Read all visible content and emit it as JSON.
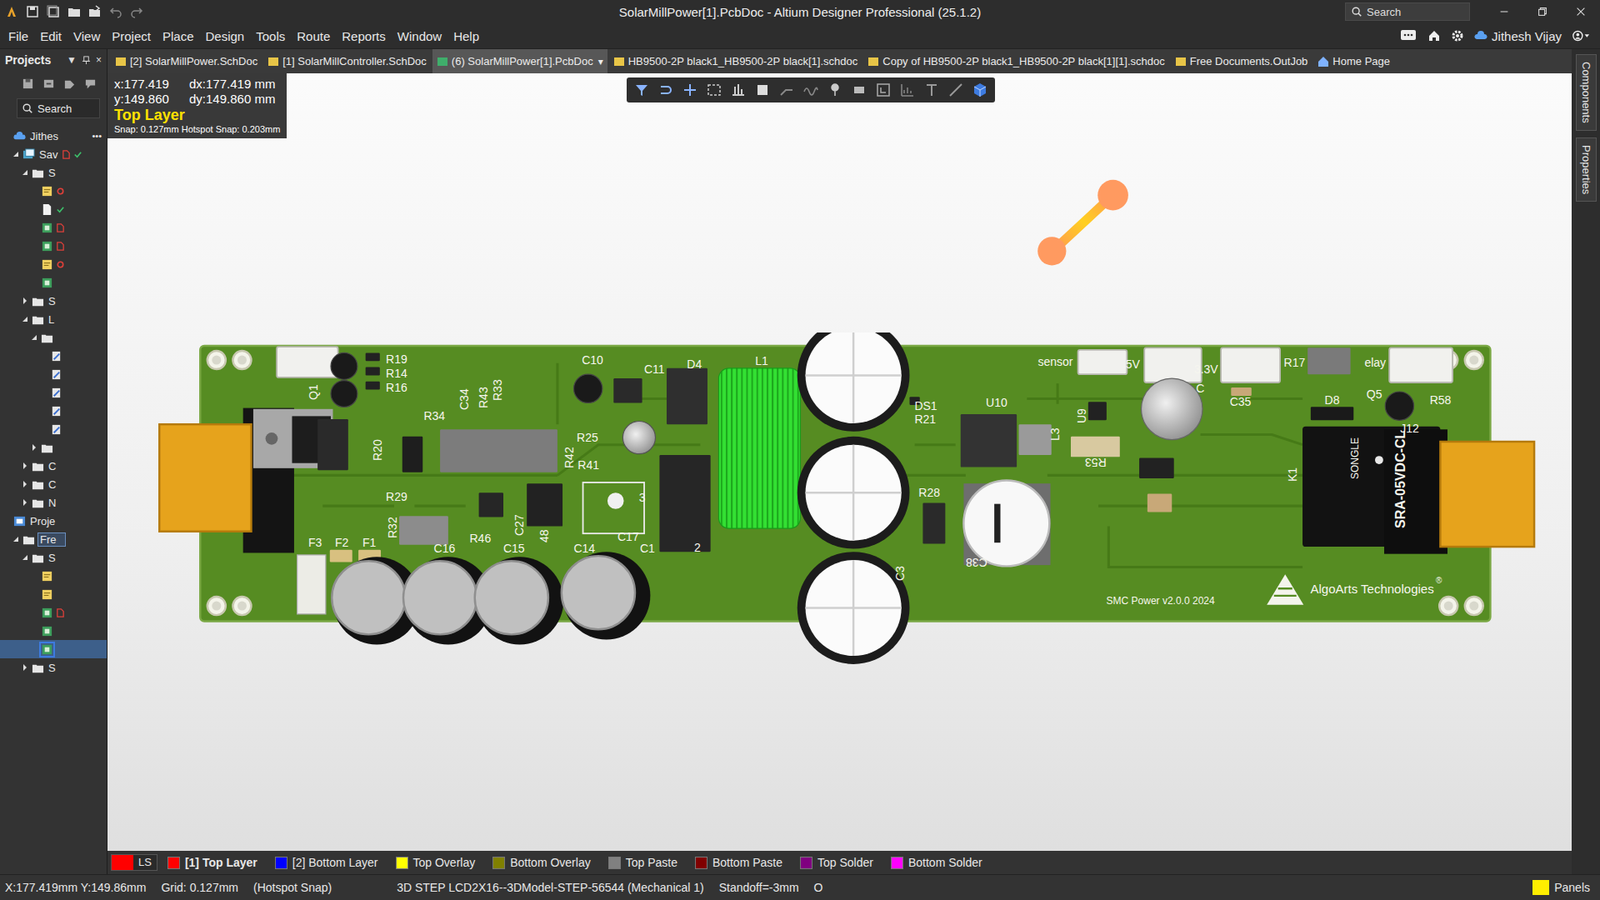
{
  "window": {
    "title": "SolarMillPower[1].PcbDoc - Altium Designer Professional (25.1.2)"
  },
  "title_bar": {
    "search": {
      "placeholder": "Search"
    }
  },
  "menu": [
    "File",
    "Edit",
    "View",
    "Project",
    "Place",
    "Design",
    "Tools",
    "Route",
    "Reports",
    "Window",
    "Help"
  ],
  "account": {
    "name": "Jithesh Vijay"
  },
  "doc_tabs": {
    "dropdown_glyph": "▾",
    "items": [
      {
        "label": "[2] SolarMillPower.SchDoc",
        "kind": "sch",
        "selected": false,
        "dropdown": false
      },
      {
        "label": "[1] SolarMillController.SchDoc",
        "kind": "sch",
        "selected": false,
        "dropdown": false
      },
      {
        "label": "(6) SolarMillPower[1].PcbDoc",
        "kind": "pcb",
        "selected": true,
        "dropdown": true
      },
      {
        "label": "HB9500-2P black1_HB9500-2P black[1].schdoc",
        "kind": "sch",
        "selected": false,
        "dropdown": false
      },
      {
        "label": "Copy of HB9500-2P black1_HB9500-2P black[1][1].schdoc",
        "kind": "sch",
        "selected": false,
        "dropdown": false
      },
      {
        "label": "Free Documents.OutJob",
        "kind": "outjob",
        "selected": false,
        "dropdown": false
      },
      {
        "label": "Home Page",
        "kind": "home",
        "selected": false,
        "dropdown": false
      }
    ]
  },
  "projects_panel": {
    "title": "Projects",
    "menu_glyph": "▼",
    "close_glyph": "×",
    "search": {
      "placeholder": "Search"
    },
    "more": "•••",
    "tree": [
      {
        "label": "Jithes",
        "depth": 0,
        "kind": "cloud",
        "expandable": false,
        "expanded": false,
        "marks": [],
        "outlined": false,
        "selected": false
      },
      {
        "label": "Sav",
        "depth": 1,
        "kind": "workspace",
        "expandable": true,
        "expanded": true,
        "marks": [
          "modified",
          "saved"
        ],
        "outlined": false,
        "selected": false
      },
      {
        "label": "S",
        "depth": 2,
        "kind": "folder",
        "expandable": true,
        "expanded": true,
        "marks": [],
        "outlined": false,
        "selected": false
      },
      {
        "label": "",
        "depth": 3,
        "kind": "sch",
        "expandable": false,
        "expanded": false,
        "marks": [
          "unsaved"
        ],
        "outlined": false,
        "selected": false
      },
      {
        "label": "",
        "depth": 3,
        "kind": "doc",
        "expandable": false,
        "expanded": false,
        "marks": [
          "saved"
        ],
        "outlined": false,
        "selected": false
      },
      {
        "label": "",
        "depth": 3,
        "kind": "pcb",
        "expandable": false,
        "expanded": false,
        "marks": [
          "modified"
        ],
        "outlined": false,
        "selected": false
      },
      {
        "label": "",
        "depth": 3,
        "kind": "pcb",
        "expandable": false,
        "expanded": false,
        "marks": [
          "modified"
        ],
        "outlined": false,
        "selected": false
      },
      {
        "label": "",
        "depth": 3,
        "kind": "sch",
        "expandable": false,
        "expanded": false,
        "marks": [
          "unsaved"
        ],
        "outlined": false,
        "selected": false
      },
      {
        "label": "",
        "depth": 3,
        "kind": "pcb",
        "expandable": false,
        "expanded": false,
        "marks": [],
        "outlined": false,
        "selected": false
      },
      {
        "label": "S",
        "depth": 2,
        "kind": "folder",
        "expandable": true,
        "expanded": false,
        "marks": [],
        "outlined": false,
        "selected": false
      },
      {
        "label": "L",
        "depth": 2,
        "kind": "folder",
        "expandable": true,
        "expanded": true,
        "marks": [],
        "outlined": false,
        "selected": false
      },
      {
        "label": "",
        "depth": 3,
        "kind": "folder",
        "expandable": true,
        "expanded": true,
        "marks": [],
        "outlined": false,
        "selected": false
      },
      {
        "label": "",
        "depth": 4,
        "kind": "lib",
        "expandable": false,
        "expanded": false,
        "marks": [],
        "outlined": false,
        "selected": false
      },
      {
        "label": "",
        "depth": 4,
        "kind": "lib",
        "expandable": false,
        "expanded": false,
        "marks": [],
        "outlined": false,
        "selected": false
      },
      {
        "label": "",
        "depth": 4,
        "kind": "lib",
        "expandable": false,
        "expanded": false,
        "marks": [],
        "outlined": false,
        "selected": false
      },
      {
        "label": "",
        "depth": 4,
        "kind": "lib",
        "expandable": false,
        "expanded": false,
        "marks": [],
        "outlined": false,
        "selected": false
      },
      {
        "label": "",
        "depth": 4,
        "kind": "lib",
        "expandable": false,
        "expanded": false,
        "marks": [],
        "outlined": false,
        "selected": false
      },
      {
        "label": "",
        "depth": 3,
        "kind": "folder",
        "expandable": true,
        "expanded": false,
        "marks": [],
        "outlined": false,
        "selected": false
      },
      {
        "label": "C",
        "depth": 2,
        "kind": "folder",
        "expandable": true,
        "expanded": false,
        "marks": [],
        "outlined": false,
        "selected": false
      },
      {
        "label": "C",
        "depth": 2,
        "kind": "folder",
        "expandable": true,
        "expanded": false,
        "marks": [],
        "outlined": false,
        "selected": false
      },
      {
        "label": "N",
        "depth": 2,
        "kind": "folder",
        "expandable": true,
        "expanded": false,
        "marks": [],
        "outlined": false,
        "selected": false
      },
      {
        "label": "Proje",
        "depth": 0,
        "kind": "project",
        "expandable": false,
        "expanded": false,
        "marks": [],
        "outlined": false,
        "selected": false
      },
      {
        "label": "Fre",
        "depth": 1,
        "kind": "folder",
        "expandable": true,
        "expanded": true,
        "marks": [],
        "outlined": true,
        "selected": false
      },
      {
        "label": "S",
        "depth": 2,
        "kind": "folder",
        "expandable": true,
        "expanded": true,
        "marks": [],
        "outlined": false,
        "selected": false
      },
      {
        "label": "",
        "depth": 3,
        "kind": "sch",
        "expandable": false,
        "expanded": false,
        "marks": [],
        "outlined": false,
        "selected": false
      },
      {
        "label": "",
        "depth": 3,
        "kind": "sch",
        "expandable": false,
        "expanded": false,
        "marks": [],
        "outlined": false,
        "selected": false
      },
      {
        "label": "",
        "depth": 3,
        "kind": "pcb",
        "expandable": false,
        "expanded": false,
        "marks": [
          "modified"
        ],
        "outlined": false,
        "selected": false
      },
      {
        "label": "",
        "depth": 3,
        "kind": "pcb",
        "expandable": false,
        "expanded": false,
        "marks": [],
        "outlined": false,
        "selected": false
      },
      {
        "label": "",
        "depth": 3,
        "kind": "pcb",
        "expandable": false,
        "expanded": false,
        "marks": [],
        "outlined": false,
        "selected": true
      },
      {
        "label": "S",
        "depth": 2,
        "kind": "folder",
        "expandable": true,
        "expanded": false,
        "marks": [],
        "outlined": false,
        "selected": false
      }
    ]
  },
  "right_panels": [
    {
      "label": "Components"
    },
    {
      "label": "Properties"
    }
  ],
  "hud": {
    "rows": [
      {
        "abs": "x:177.419",
        "delta": "dx:177.419 mm"
      },
      {
        "abs": "y:149.860",
        "delta": "dy:149.860 mm"
      }
    ],
    "layer": "Top Layer",
    "snap": "Snap: 0.127mm Hotspot Snap: 0.203mm"
  },
  "board": {
    "labels": [
      "R19",
      "R14",
      "R16",
      "Q1",
      "R20",
      "C10",
      "C11",
      "D4",
      "L1",
      "C34",
      "R43",
      "R33",
      "R34",
      "R25",
      "R42",
      "R41",
      "R29",
      "R32",
      "C16",
      "R46",
      "C15",
      "C27",
      "48",
      "C14",
      "C1",
      "C17",
      "3",
      "2",
      "DS1",
      "R21",
      "U10",
      "L3",
      "U9",
      "R53",
      "R28",
      "C38",
      "C3",
      "sensor",
      "5V",
      "3.3V",
      "R17",
      "elay",
      "C35",
      "D8",
      "Q5",
      "R58",
      "J12",
      "K1",
      "F3",
      "F2",
      "F1",
      "C"
    ],
    "version": "SMC Power v2.0.0 2024",
    "company": "AlgoArts Technologies",
    "trademark": "®",
    "relay_brand": "SONGLE",
    "relay_part": "SRA-05VDC-CL"
  },
  "layer_bar": {
    "ls": {
      "label": "LS",
      "color": "#ff0000"
    },
    "layers": [
      {
        "label": "[1] Top Layer",
        "color": "#ff0000",
        "selected": true
      },
      {
        "label": "[2] Bottom Layer",
        "color": "#0000ff",
        "selected": false
      },
      {
        "label": "Top Overlay",
        "color": "#ffff00",
        "selected": false
      },
      {
        "label": "Bottom Overlay",
        "color": "#808000",
        "selected": false
      },
      {
        "label": "Top Paste",
        "color": "#808080",
        "selected": false
      },
      {
        "label": "Bottom Paste",
        "color": "#800000",
        "selected": false
      },
      {
        "label": "Top Solder",
        "color": "#800080",
        "selected": false
      },
      {
        "label": "Bottom Solder",
        "color": "#ff00ff",
        "selected": false
      }
    ]
  },
  "status_bar": {
    "items": [
      "X:177.419mm Y:149.86mm",
      "Grid: 0.127mm",
      "(Hotspot Snap)",
      "3D STEP LCD2X16--3DModel-STEP-56544 (Mechanical 1)",
      "Standoff=-3mm",
      "O"
    ],
    "panels": {
      "label": "Panels",
      "color": "#ffee00"
    }
  }
}
